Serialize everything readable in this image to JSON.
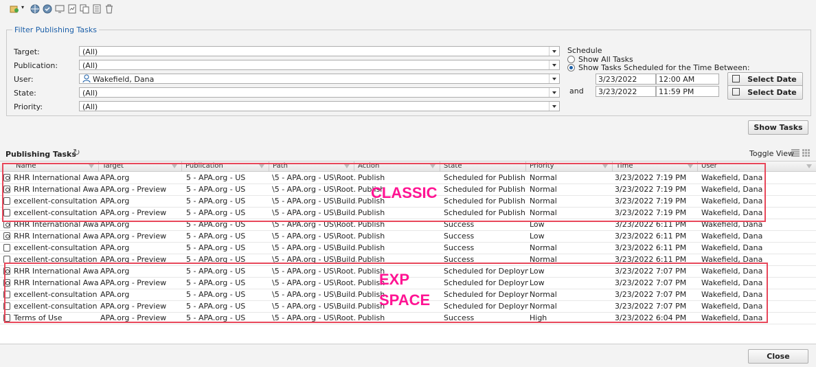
{
  "toolbar": {
    "icons": [
      "new-task-icon",
      "globe-icon",
      "globe-check-icon",
      "monitor-icon",
      "report-icon",
      "copy-icon",
      "details-icon",
      "trash-icon"
    ]
  },
  "filter": {
    "legend": "Filter Publishing Tasks",
    "target": {
      "label": "Target:",
      "value": "(All)"
    },
    "publication": {
      "label": "Publication:",
      "value": "(All)"
    },
    "user": {
      "label": "User:",
      "value": "Wakefield, Dana"
    },
    "state": {
      "label": "State:",
      "value": "(All)"
    },
    "priority": {
      "label": "Priority:",
      "value": "(All)"
    },
    "schedule": {
      "title": "Schedule",
      "show_all": "Show All Tasks",
      "show_between": "Show Tasks Scheduled for the Time Between:",
      "from_date": "3/23/2022",
      "from_time": "12:00 AM",
      "and_label": "and",
      "to_date": "3/23/2022",
      "to_time": "11:59 PM",
      "select_date": "Select Date"
    },
    "show_tasks": "Show Tasks"
  },
  "grid": {
    "title": "Publishing Tasks",
    "toggle_view": "Toggle View",
    "columns": [
      "Name",
      "Target",
      "Publication",
      "Path",
      "Action",
      "State",
      "Priority",
      "Time",
      "User"
    ],
    "rows": [
      {
        "icon": "pub",
        "name": "RHR International Awa...",
        "target": "APA.org",
        "publication": "5 - APA.org - US",
        "path": "\\5 - APA.org - US\\Root...",
        "action": "Publish",
        "state": "Scheduled for Publish",
        "priority": "Normal",
        "time": "3/23/2022 7:19 PM",
        "user": "Wakefield, Dana"
      },
      {
        "icon": "pub",
        "name": "RHR International Awa...",
        "target": "APA.org - Preview",
        "publication": "5 - APA.org - US",
        "path": "\\5 - APA.org - US\\Root...",
        "action": "Publish",
        "state": "Scheduled for Publish",
        "priority": "Normal",
        "time": "3/23/2022 7:19 PM",
        "user": "Wakefield, Dana"
      },
      {
        "icon": "page",
        "name": "excellent-consultation",
        "target": "APA.org",
        "publication": "5 - APA.org - US",
        "path": "\\5 - APA.org - US\\Build...",
        "action": "Publish",
        "state": "Scheduled for Publish",
        "priority": "Normal",
        "time": "3/23/2022 7:19 PM",
        "user": "Wakefield, Dana"
      },
      {
        "icon": "page",
        "name": "excellent-consultation",
        "target": "APA.org - Preview",
        "publication": "5 - APA.org - US",
        "path": "\\5 - APA.org - US\\Build...",
        "action": "Publish",
        "state": "Scheduled for Publish",
        "priority": "Normal",
        "time": "3/23/2022 7:19 PM",
        "user": "Wakefield, Dana"
      },
      {
        "icon": "pub",
        "name": "RHR International Awa...",
        "target": "APA.org",
        "publication": "5 - APA.org - US",
        "path": "\\5 - APA.org - US\\Root...",
        "action": "Publish",
        "state": "Success",
        "priority": "Low",
        "time": "3/23/2022 6:11 PM",
        "user": "Wakefield, Dana"
      },
      {
        "icon": "pub",
        "name": "RHR International Awa...",
        "target": "APA.org - Preview",
        "publication": "5 - APA.org - US",
        "path": "\\5 - APA.org - US\\Root...",
        "action": "Publish",
        "state": "Success",
        "priority": "Low",
        "time": "3/23/2022 6:11 PM",
        "user": "Wakefield, Dana"
      },
      {
        "icon": "page",
        "name": "excellent-consultation",
        "target": "APA.org",
        "publication": "5 - APA.org - US",
        "path": "\\5 - APA.org - US\\Build...",
        "action": "Publish",
        "state": "Success",
        "priority": "Normal",
        "time": "3/23/2022 6:11 PM",
        "user": "Wakefield, Dana"
      },
      {
        "icon": "page",
        "name": "excellent-consultation",
        "target": "APA.org - Preview",
        "publication": "5 - APA.org - US",
        "path": "\\5 - APA.org - US\\Build...",
        "action": "Publish",
        "state": "Success",
        "priority": "Normal",
        "time": "3/23/2022 6:11 PM",
        "user": "Wakefield, Dana"
      },
      {
        "icon": "pub",
        "name": "RHR International Awa...",
        "target": "APA.org",
        "publication": "5 - APA.org - US",
        "path": "\\5 - APA.org - US\\Root...",
        "action": "Publish",
        "state": "Scheduled for Deploym...",
        "priority": "Low",
        "time": "3/23/2022 7:07 PM",
        "user": "Wakefield, Dana"
      },
      {
        "icon": "pub",
        "name": "RHR International Awa...",
        "target": "APA.org - Preview",
        "publication": "5 - APA.org - US",
        "path": "\\5 - APA.org - US\\Root...",
        "action": "Publish",
        "state": "Scheduled for Deploym...",
        "priority": "Low",
        "time": "3/23/2022 7:07 PM",
        "user": "Wakefield, Dana"
      },
      {
        "icon": "page",
        "name": "excellent-consultation",
        "target": "APA.org",
        "publication": "5 - APA.org - US",
        "path": "\\5 - APA.org - US\\Build...",
        "action": "Publish",
        "state": "Scheduled for Deploym...",
        "priority": "Normal",
        "time": "3/23/2022 7:07 PM",
        "user": "Wakefield, Dana"
      },
      {
        "icon": "page",
        "name": "excellent-consultation",
        "target": "APA.org - Preview",
        "publication": "5 - APA.org - US",
        "path": "\\5 - APA.org - US\\Build...",
        "action": "Publish",
        "state": "Scheduled for Deploym...",
        "priority": "Normal",
        "time": "3/23/2022 7:07 PM",
        "user": "Wakefield, Dana"
      },
      {
        "icon": "page",
        "name": "Terms of Use",
        "target": "APA.org - Preview",
        "publication": "5 - APA.org - US",
        "path": "\\5 - APA.org - US\\Root...",
        "action": "Publish",
        "state": "Success",
        "priority": "High",
        "time": "3/23/2022 6:04 PM",
        "user": "Wakefield, Dana"
      }
    ]
  },
  "annotations": {
    "classic": "CLASSIC",
    "exp": "EXP",
    "space": "SPACE",
    "color": "#ff1493",
    "box_color": "#e8475a"
  },
  "footer": {
    "close": "Close"
  }
}
